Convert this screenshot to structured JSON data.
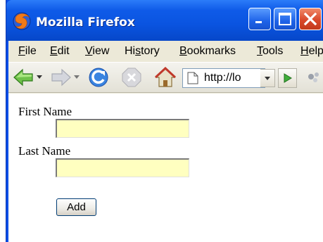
{
  "window": {
    "title": "Mozilla Firefox"
  },
  "menubar": {
    "items": [
      {
        "label": "File",
        "underline": "F",
        "rest": "ile"
      },
      {
        "label": "Edit",
        "underline": "E",
        "rest": "dit"
      },
      {
        "label": "View",
        "underline": "V",
        "rest": "iew"
      },
      {
        "label": "History",
        "prefix": "Hi",
        "underline": "s",
        "rest": "tory"
      },
      {
        "label": "Bookmarks",
        "underline": "B",
        "rest": "ookmarks"
      },
      {
        "label": "Tools",
        "underline": "T",
        "rest": "ools"
      },
      {
        "label": "Help",
        "underline": "H",
        "rest": "elp"
      }
    ]
  },
  "toolbar": {
    "url": "http://lo",
    "icons": [
      "back-arrow-icon",
      "forward-arrow-icon",
      "reload-icon",
      "stop-icon",
      "home-icon",
      "page-icon",
      "go-icon",
      "throbber-icon"
    ]
  },
  "form": {
    "first_name_label": "First Name",
    "first_name_value": "",
    "last_name_label": "Last Name",
    "last_name_value": "",
    "add_button_label": "Add"
  },
  "colors": {
    "titlebar": "#0a54e0",
    "chrome": "#ece9d8",
    "field_bg": "#ffffc0",
    "close_button": "#d9482a"
  }
}
